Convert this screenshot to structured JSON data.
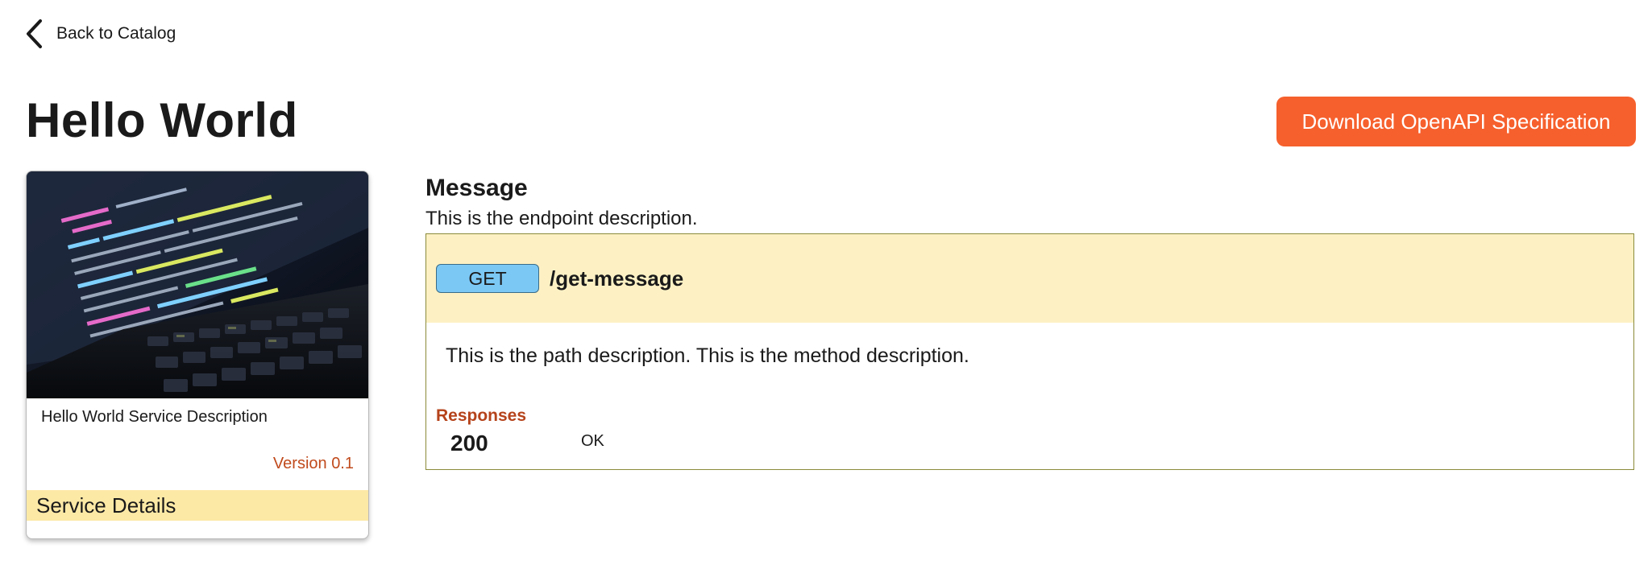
{
  "nav": {
    "back_label": "Back to Catalog"
  },
  "header": {
    "title": "Hello World",
    "download_label": "Download OpenAPI Specification"
  },
  "service_card": {
    "description": "Hello World Service Description",
    "version": "Version 0.1",
    "details_label": "Service Details"
  },
  "endpoint": {
    "title": "Message",
    "description": "This is the endpoint description.",
    "method": "GET",
    "path": "/get-message",
    "path_description": "This is the path description. This is the method description.",
    "responses_label": "Responses",
    "responses": [
      {
        "code": "200",
        "text": "OK"
      }
    ]
  },
  "colors": {
    "accent": "#f6602d",
    "method_get": "#7cc8f5",
    "endpoint_header_bg": "#fdf1c4",
    "details_bg": "#fde9a6",
    "version_text": "#c04a1c"
  }
}
